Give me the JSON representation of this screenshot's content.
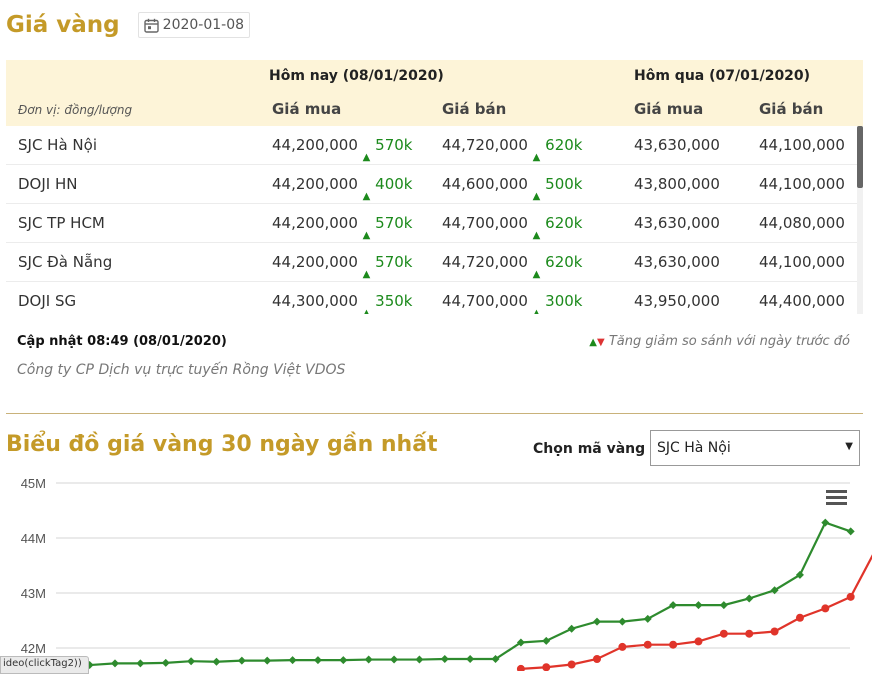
{
  "page": {
    "title": "Giá vàng",
    "date": "2020-01-08"
  },
  "table": {
    "today_header": "Hôm nay (08/01/2020)",
    "yesterday_header": "Hôm qua (07/01/2020)",
    "unit_label": "Đơn vị: đồng/lượng",
    "buy_label": "Giá mua",
    "sell_label": "Giá bán",
    "rows": [
      {
        "name": "SJC Hà Nội",
        "buy": "44,200,000",
        "buy_change": "570k",
        "sell": "44,720,000",
        "sell_change": "620k",
        "prev_buy": "43,630,000",
        "prev_sell": "44,100,000"
      },
      {
        "name": "DOJI HN",
        "buy": "44,200,000",
        "buy_change": "400k",
        "sell": "44,600,000",
        "sell_change": "500k",
        "prev_buy": "43,800,000",
        "prev_sell": "44,100,000"
      },
      {
        "name": "SJC TP HCM",
        "buy": "44,200,000",
        "buy_change": "570k",
        "sell": "44,700,000",
        "sell_change": "620k",
        "prev_buy": "43,630,000",
        "prev_sell": "44,080,000"
      },
      {
        "name": "SJC Đà Nẵng",
        "buy": "44,200,000",
        "buy_change": "570k",
        "sell": "44,720,000",
        "sell_change": "620k",
        "prev_buy": "43,630,000",
        "prev_sell": "44,100,000"
      },
      {
        "name": "DOJI SG",
        "buy": "44,300,000",
        "buy_change": "350k",
        "sell": "44,700,000",
        "sell_change": "300k",
        "prev_buy": "43,950,000",
        "prev_sell": "44,400,000"
      }
    ]
  },
  "footer": {
    "updated": "Cập nhật 08:49 (08/01/2020)",
    "legend_note": "Tăng giảm so sánh với ngày trước đó",
    "company": "Công ty CP Dịch vụ trực tuyến Rồng Việt VDOS"
  },
  "chart_section": {
    "title": "Biểu đồ giá vàng 30 ngày gần nhất",
    "select_label": "Chọn mã vàng",
    "select_value": "SJC Hà Nội"
  },
  "status_tip": "ideo(clickTag2))",
  "colors": {
    "accent": "#c49a28",
    "up": "#1c8a1c",
    "down": "#d33333",
    "sell_series": "#2e8b2e",
    "buy_series": "#e0342a"
  },
  "icons": {
    "date": "calendar-icon",
    "menu": "hamburger-menu-icon",
    "select": "chevron-down-icon"
  },
  "chart_data": {
    "type": "line",
    "title": "Biểu đồ giá vàng 30 ngày gần nhất",
    "xlabel": "",
    "ylabel": "",
    "ylim": [
      41.7,
      45
    ],
    "yticks": [
      "42M",
      "43M",
      "44M",
      "45M"
    ],
    "ytick_values": [
      42,
      43,
      44,
      45
    ],
    "grid": true,
    "legend": "none",
    "x": [
      1,
      2,
      3,
      4,
      5,
      6,
      7,
      8,
      9,
      10,
      11,
      12,
      13,
      14,
      15,
      16,
      17,
      18,
      19,
      20,
      21,
      22,
      23,
      24,
      25,
      26,
      27,
      28,
      29,
      30
    ],
    "series": [
      {
        "marker": "diamond",
        "color": "#2e8b2e",
        "values": [
          41.66,
          41.69,
          41.72,
          41.72,
          41.73,
          41.76,
          41.75,
          41.77,
          41.77,
          41.78,
          41.78,
          41.78,
          41.79,
          41.79,
          41.79,
          41.8,
          41.8,
          41.8,
          42.1,
          42.13,
          42.35,
          42.48,
          42.48,
          42.53,
          42.78,
          42.78,
          42.78,
          42.9,
          43.05,
          43.33,
          44.28,
          44.12
        ]
      },
      {
        "marker": "circle",
        "color": "#e0342a",
        "values": [
          null,
          null,
          null,
          null,
          null,
          null,
          null,
          null,
          null,
          null,
          null,
          null,
          null,
          null,
          null,
          null,
          null,
          null,
          41.62,
          41.65,
          41.7,
          41.8,
          42.02,
          42.06,
          42.06,
          42.12,
          42.26,
          42.26,
          42.3,
          42.55,
          42.72,
          42.93,
          43.8,
          43.65
        ]
      }
    ]
  }
}
